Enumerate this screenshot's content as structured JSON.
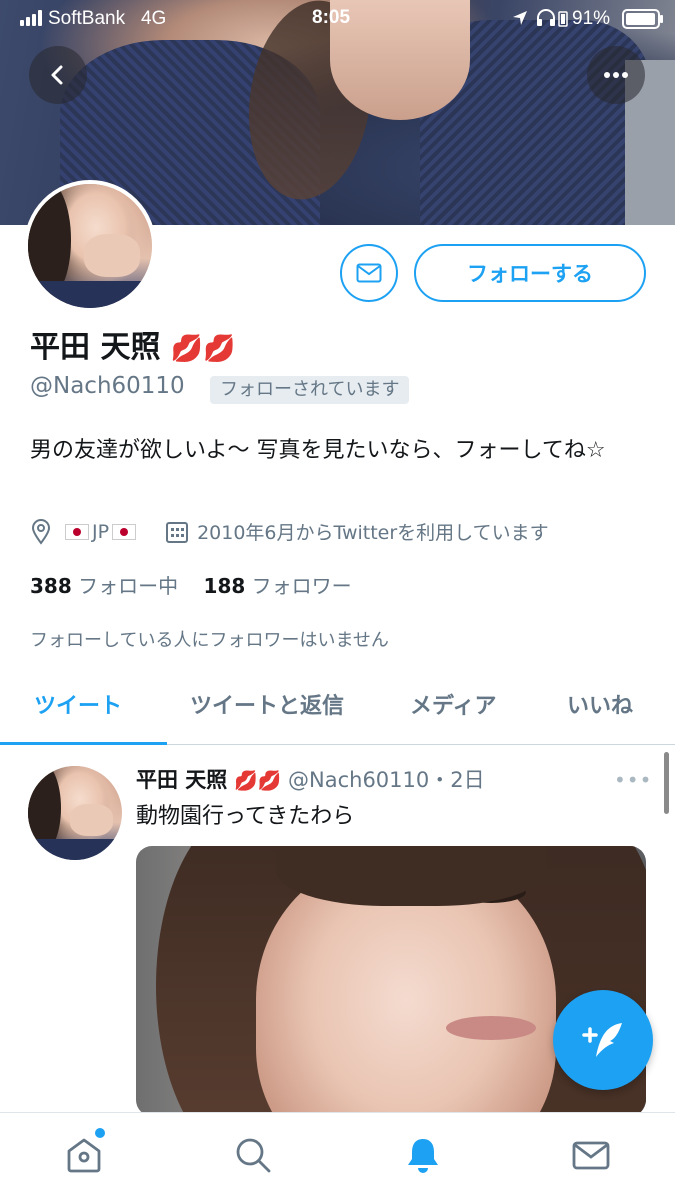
{
  "status_bar": {
    "carrier": "SoftBank",
    "network": "4G",
    "time": "8:05",
    "battery": "91%"
  },
  "profile": {
    "display_name": "平田 天照",
    "name_emoji": "💋💋",
    "handle": "@Nach60110",
    "follows_you": "フォローされています",
    "bio": "男の友達が欲しいよ〜 写真を見たいなら、フォーしてね☆",
    "location": "JP",
    "joined": "2010年6月からTwitterを利用しています",
    "following_count": "388",
    "following_label": "フォロー中",
    "followers_count": "188",
    "followers_label": "フォロワー",
    "common_followers": "フォローしている人にフォロワーはいません"
  },
  "actions": {
    "follow_label": "フォローする"
  },
  "tabs": [
    {
      "label": "ツイート",
      "active": true
    },
    {
      "label": "ツイートと返信",
      "active": false
    },
    {
      "label": "メディア",
      "active": false
    },
    {
      "label": "いいね",
      "active": false
    }
  ],
  "tweet": {
    "name": "平田 天照",
    "emoji": "💋💋",
    "handle": "@Nach60110",
    "time": "・2日",
    "text": "動物園行ってきたわら"
  },
  "nav": {
    "items": [
      "home-icon",
      "search-icon",
      "notifications-icon",
      "messages-icon"
    ],
    "active": "notifications-icon"
  },
  "colors": {
    "accent": "#1da1f2",
    "secondary_text": "#657786"
  }
}
